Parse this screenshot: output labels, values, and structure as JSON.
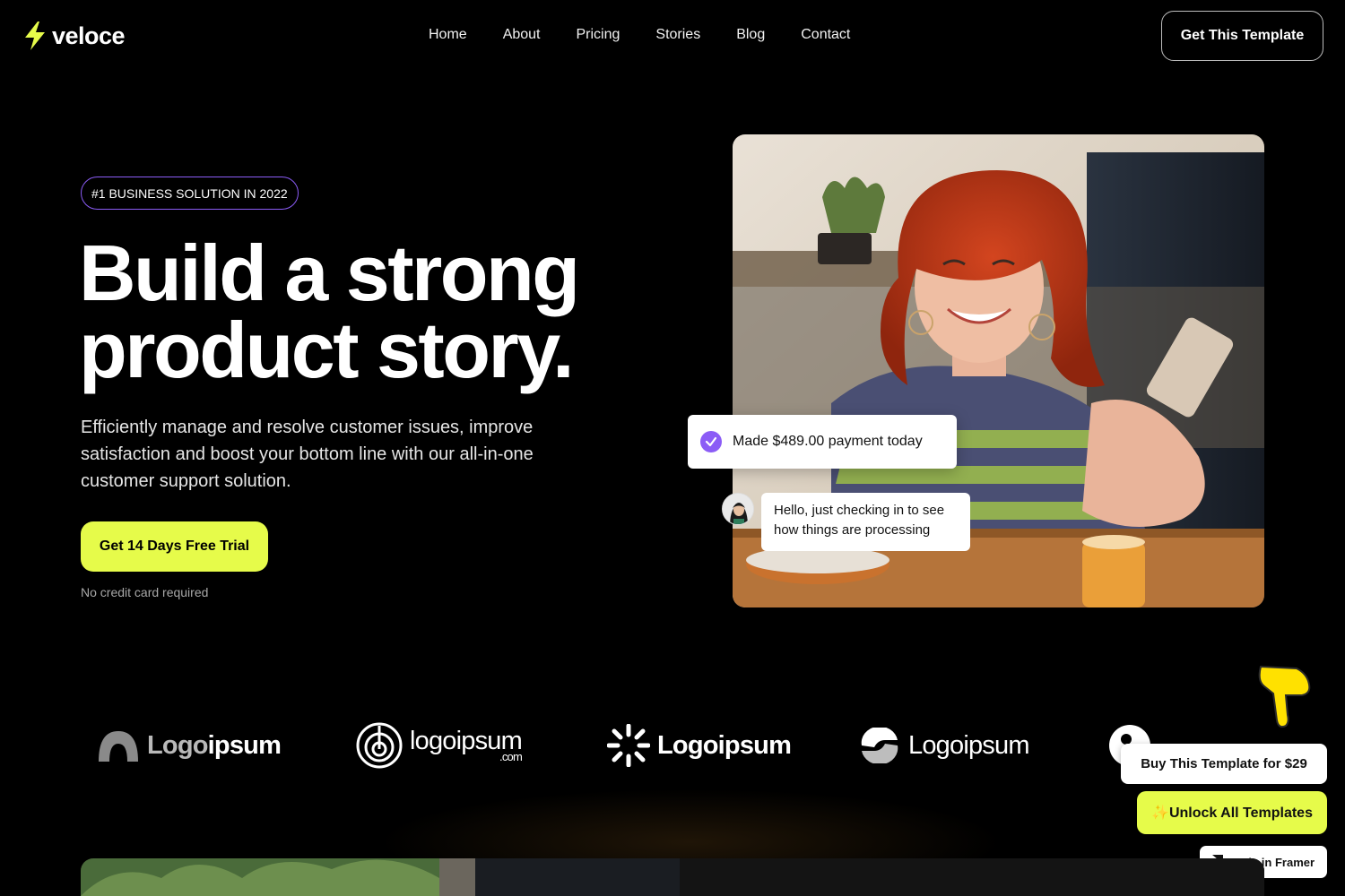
{
  "brand": {
    "name": "veloce",
    "accent": "#e6fb4a",
    "purple": "#8b5cf6"
  },
  "nav": {
    "links": [
      "Home",
      "About",
      "Pricing",
      "Stories",
      "Blog",
      "Contact"
    ],
    "cta": "Get This Template"
  },
  "hero": {
    "badge": "#1 BUSINESS SOLUTION IN 2022",
    "headline_line1": "Build a strong",
    "headline_line2": "product story.",
    "subtext": "Efficiently manage and resolve customer issues, improve satisfaction and boost your bottom line with our all-in-one customer support solution.",
    "trial_button": "Get 14 Days Free Trial",
    "no_card": "No credit card required"
  },
  "overlays": {
    "payment": "Made $489.00 payment today",
    "chat": "Hello, just checking in to see how things are processing"
  },
  "logos": [
    {
      "bold": "Logo",
      "light": "ipsum"
    },
    {
      "bold": "logoipsum",
      "light": ".com"
    },
    {
      "bold": "Logoipsum",
      "light": ""
    },
    {
      "bold": "Logoipsum",
      "light": ""
    }
  ],
  "purchase": {
    "buy": "Buy This Template for $29",
    "unlock": "✨Unlock All Templates",
    "framer": "Made in Framer"
  }
}
